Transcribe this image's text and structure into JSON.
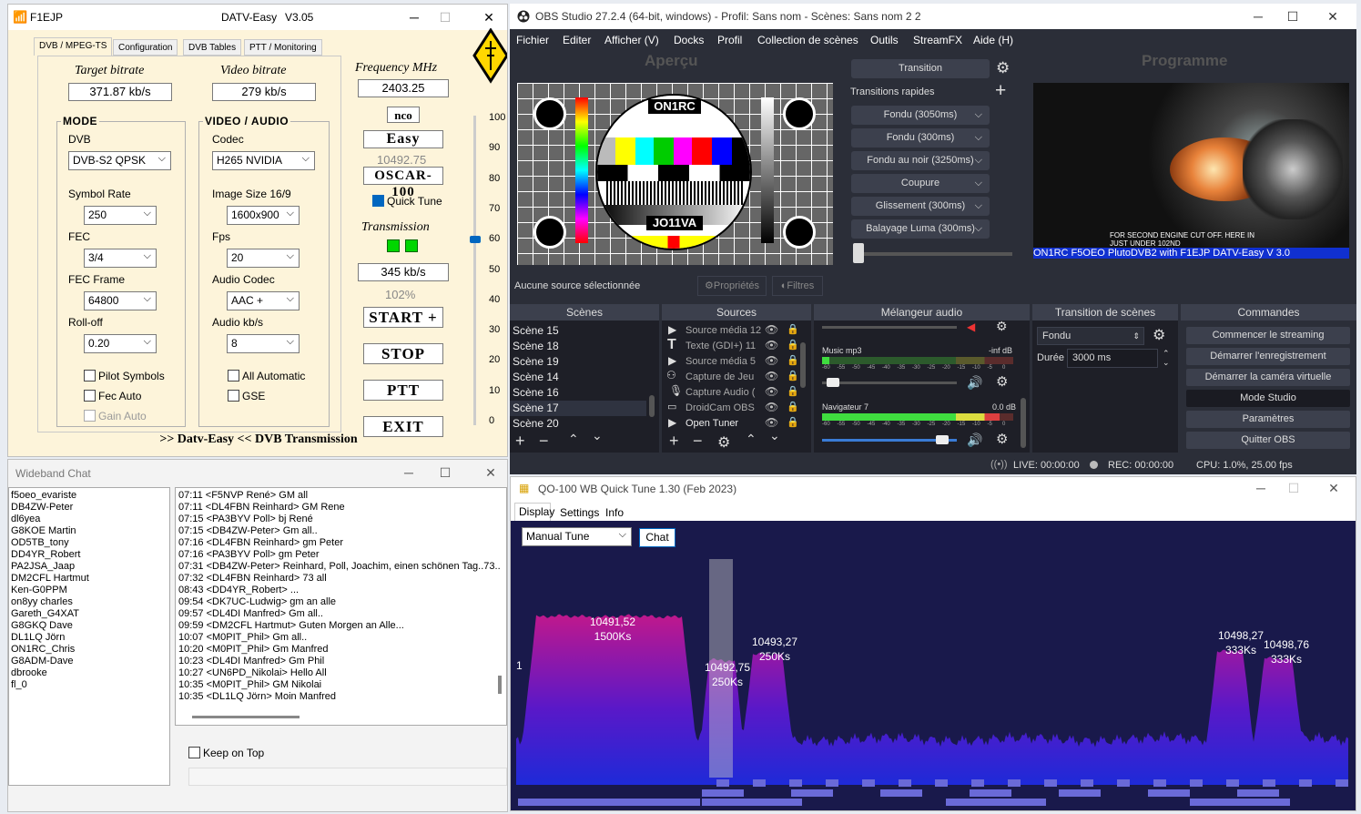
{
  "datv": {
    "title_call": "F1EJP",
    "title_app": "DATV-Easy",
    "title_version": "V3.05",
    "tabs": [
      "DVB / MPEG-TS",
      "Configuration",
      "DVB Tables",
      "PTT / Monitoring"
    ],
    "target_bitrate_label": "Target bitrate",
    "target_bitrate": "371.87 kb/s",
    "video_bitrate_label": "Video bitrate",
    "video_bitrate": "279 kb/s",
    "mode_label": "MODE",
    "dvb_label": "DVB",
    "dvb_value": "DVB-S2  QPSK",
    "symbol_rate_label": "Symbol Rate",
    "symbol_rate": "250",
    "fec_label": "FEC",
    "fec": "3/4",
    "fec_frame_label": "FEC Frame",
    "fec_frame": "64800",
    "rolloff_label": "Roll-off",
    "rolloff": "0.20",
    "pilot_symbols": "Pilot Symbols",
    "fec_auto": "Fec Auto",
    "gain_auto": "Gain Auto",
    "va_label": "VIDEO / AUDIO",
    "codec_label": "Codec",
    "codec": "H265 NVIDIA",
    "image_size_label": "Image Size 16/9",
    "image_size": "1600x900",
    "fps_label": "Fps",
    "fps": "20",
    "audio_codec_label": "Audio Codec",
    "audio_codec": "AAC +",
    "audio_kbs_label": "Audio kb/s",
    "audio_kbs": "8",
    "all_automatic": "All Automatic",
    "gse": "GSE",
    "freq_label": "Frequency MHz",
    "freq": "2403.25",
    "nco": "nco",
    "easy": "Easy",
    "downlink": "10492.75",
    "oscar": "OSCAR-100",
    "quick_tune": "Quick Tune",
    "transmission_label": "Transmission",
    "tx_rate": "345 kb/s",
    "percent": "102%",
    "start": "START +",
    "stop": "STOP",
    "ptt": "PTT",
    "exit": "EXIT",
    "footer": ">> Datv-Easy <<  DVB Transmission",
    "scale": [
      "100",
      "90",
      "80",
      "70",
      "60",
      "50",
      "40",
      "30",
      "20",
      "10",
      "0"
    ],
    "slider_level": 60
  },
  "obs": {
    "title": "OBS Studio 27.2.4 (64-bit, windows) - Profil: Sans nom - Scènes: Sans nom 2 2",
    "menu": [
      "Fichier",
      "Editer",
      "Afficher (V)",
      "Docks",
      "Profil",
      "Collection de scènes",
      "Outils",
      "StreamFX",
      "Aide (H)"
    ],
    "apercu": "Aperçu",
    "programme": "Programme",
    "test_top": "ON1RC",
    "test_bottom": "JO11VA",
    "transition_btn": "Transition",
    "transitions_rapides": "Transitions rapides",
    "transitions": [
      "Fondu (3050ms)",
      "Fondu (300ms)",
      "Fondu au noir (3250ms)",
      "Coupure",
      "Glissement (300ms)",
      "Balayage Luma (300ms)"
    ],
    "no_source": "Aucune source sélectionnée",
    "properties": "Propriétés",
    "filters": "Filtres",
    "program_overlay": "FOR SECOND ENGINE CUT OFF. HERE IN JUST UNDER 102ND",
    "program_ticker": "ON1RC      F5OEO PlutoDVB2   with    F1EJP   DATV-Easy V 3.0",
    "docks": {
      "scenes": "Scènes",
      "sources": "Sources",
      "mixer": "Mélangeur audio",
      "transition": "Transition de scènes",
      "commands": "Commandes"
    },
    "scenes": [
      "Scène 15",
      "Scène 18",
      "Scène 19",
      "Scène 14",
      "Scène 16",
      "Scène 17",
      "Scène 20"
    ],
    "sources": [
      "Source média 12",
      "Texte (GDI+) 11",
      "Source média 5",
      "Capture de Jeu",
      "Capture Audio (",
      "DroidCam OBS",
      "Open Tuner"
    ],
    "mixer": [
      {
        "name": "Music mp3",
        "db": "-inf dB",
        "level": 0.04
      },
      {
        "name": "Navigateur 7",
        "db": "0.0 dB",
        "level": 0.93
      }
    ],
    "meter_scale": [
      "-60",
      "-55",
      "-50",
      "-45",
      "-40",
      "-35",
      "-30",
      "-25",
      "-20",
      "-15",
      "-10",
      "-5",
      "0"
    ],
    "trans_type": "Fondu",
    "duree_label": "Durée",
    "duree": "3000 ms",
    "commands": [
      "Commencer le streaming",
      "Démarrer l'enregistrement",
      "Démarrer la caméra virtuelle",
      "Mode Studio",
      "Paramètres",
      "Quitter OBS"
    ],
    "status_live": "LIVE: 00:00:00",
    "status_rec": "REC: 00:00:00",
    "status_cpu": "CPU: 1.0%, 25.00 fps"
  },
  "chat": {
    "title": "Wideband Chat",
    "nicks": [
      "f5oeo_evariste",
      "DB4ZW-Peter",
      "dl6yea",
      "G8KOE Martin",
      "OD5TB_tony",
      "DD4YR_Robert",
      "PA2JSA_Jaap",
      "DM2CFL Hartmut",
      "Ken-G0PPM",
      "on8yy charles",
      "Gareth_G4XAT",
      "G8GKQ Dave",
      "DL1LQ Jörn",
      "ON1RC_Chris",
      "G8ADM-Dave",
      "dbrooke",
      "fl_0"
    ],
    "messages": [
      "07:11 <F5NVP René> GM all",
      "07:11 <DL4FBN Reinhard> GM Rene",
      "07:15 <PA3BYV Poll> bj René",
      "07:15 <DB4ZW-Peter> Gm all..",
      "07:16 <DL4FBN Reinhard> gm Peter",
      "07:16 <PA3BYV Poll> gm Peter",
      "07:31 <DB4ZW-Peter> Reinhard, Poll, Joachim, einen schönen Tag..73..",
      "07:32 <DL4FBN Reinhard> 73 all",
      "08:43 <DD4YR_Robert> ...",
      "09:54 <DK7UC-Ludwig> gm an alle",
      "09:57 <DL4DI Manfred> Gm all..",
      "09:59 <DM2CFL Hartmut> Guten Morgen an Alle...",
      "10:07 <M0PIT_Phil> Gm all..",
      "10:20 <M0PIT_Phil> Gm Manfred",
      "10:23 <DL4DI Manfred> Gm Phil",
      "10:27 <UN6PD_Nikolai> Hello All",
      "10:35 <M0PIT_Phil> GM Nikolai",
      "10:35 <DL1LQ Jörn> Moin Manfred"
    ],
    "keep_on_top": "Keep on Top"
  },
  "qo": {
    "title": "QO-100 WB Quick Tune 1.30 (Feb  2023)",
    "tabs": [
      "Display",
      "Settings",
      "Info"
    ],
    "mode": "Manual Tune",
    "chat_btn": "Chat",
    "axis_label": "1",
    "peaks": [
      {
        "freq": "10491,52",
        "sr": "1500Ks"
      },
      {
        "freq": "10492,75",
        "sr": "250Ks"
      },
      {
        "freq": "10493,27",
        "sr": "250Ks"
      },
      {
        "freq": "10498,27",
        "sr": "333Ks"
      },
      {
        "freq": "10498,76",
        "sr": "333Ks"
      }
    ]
  }
}
